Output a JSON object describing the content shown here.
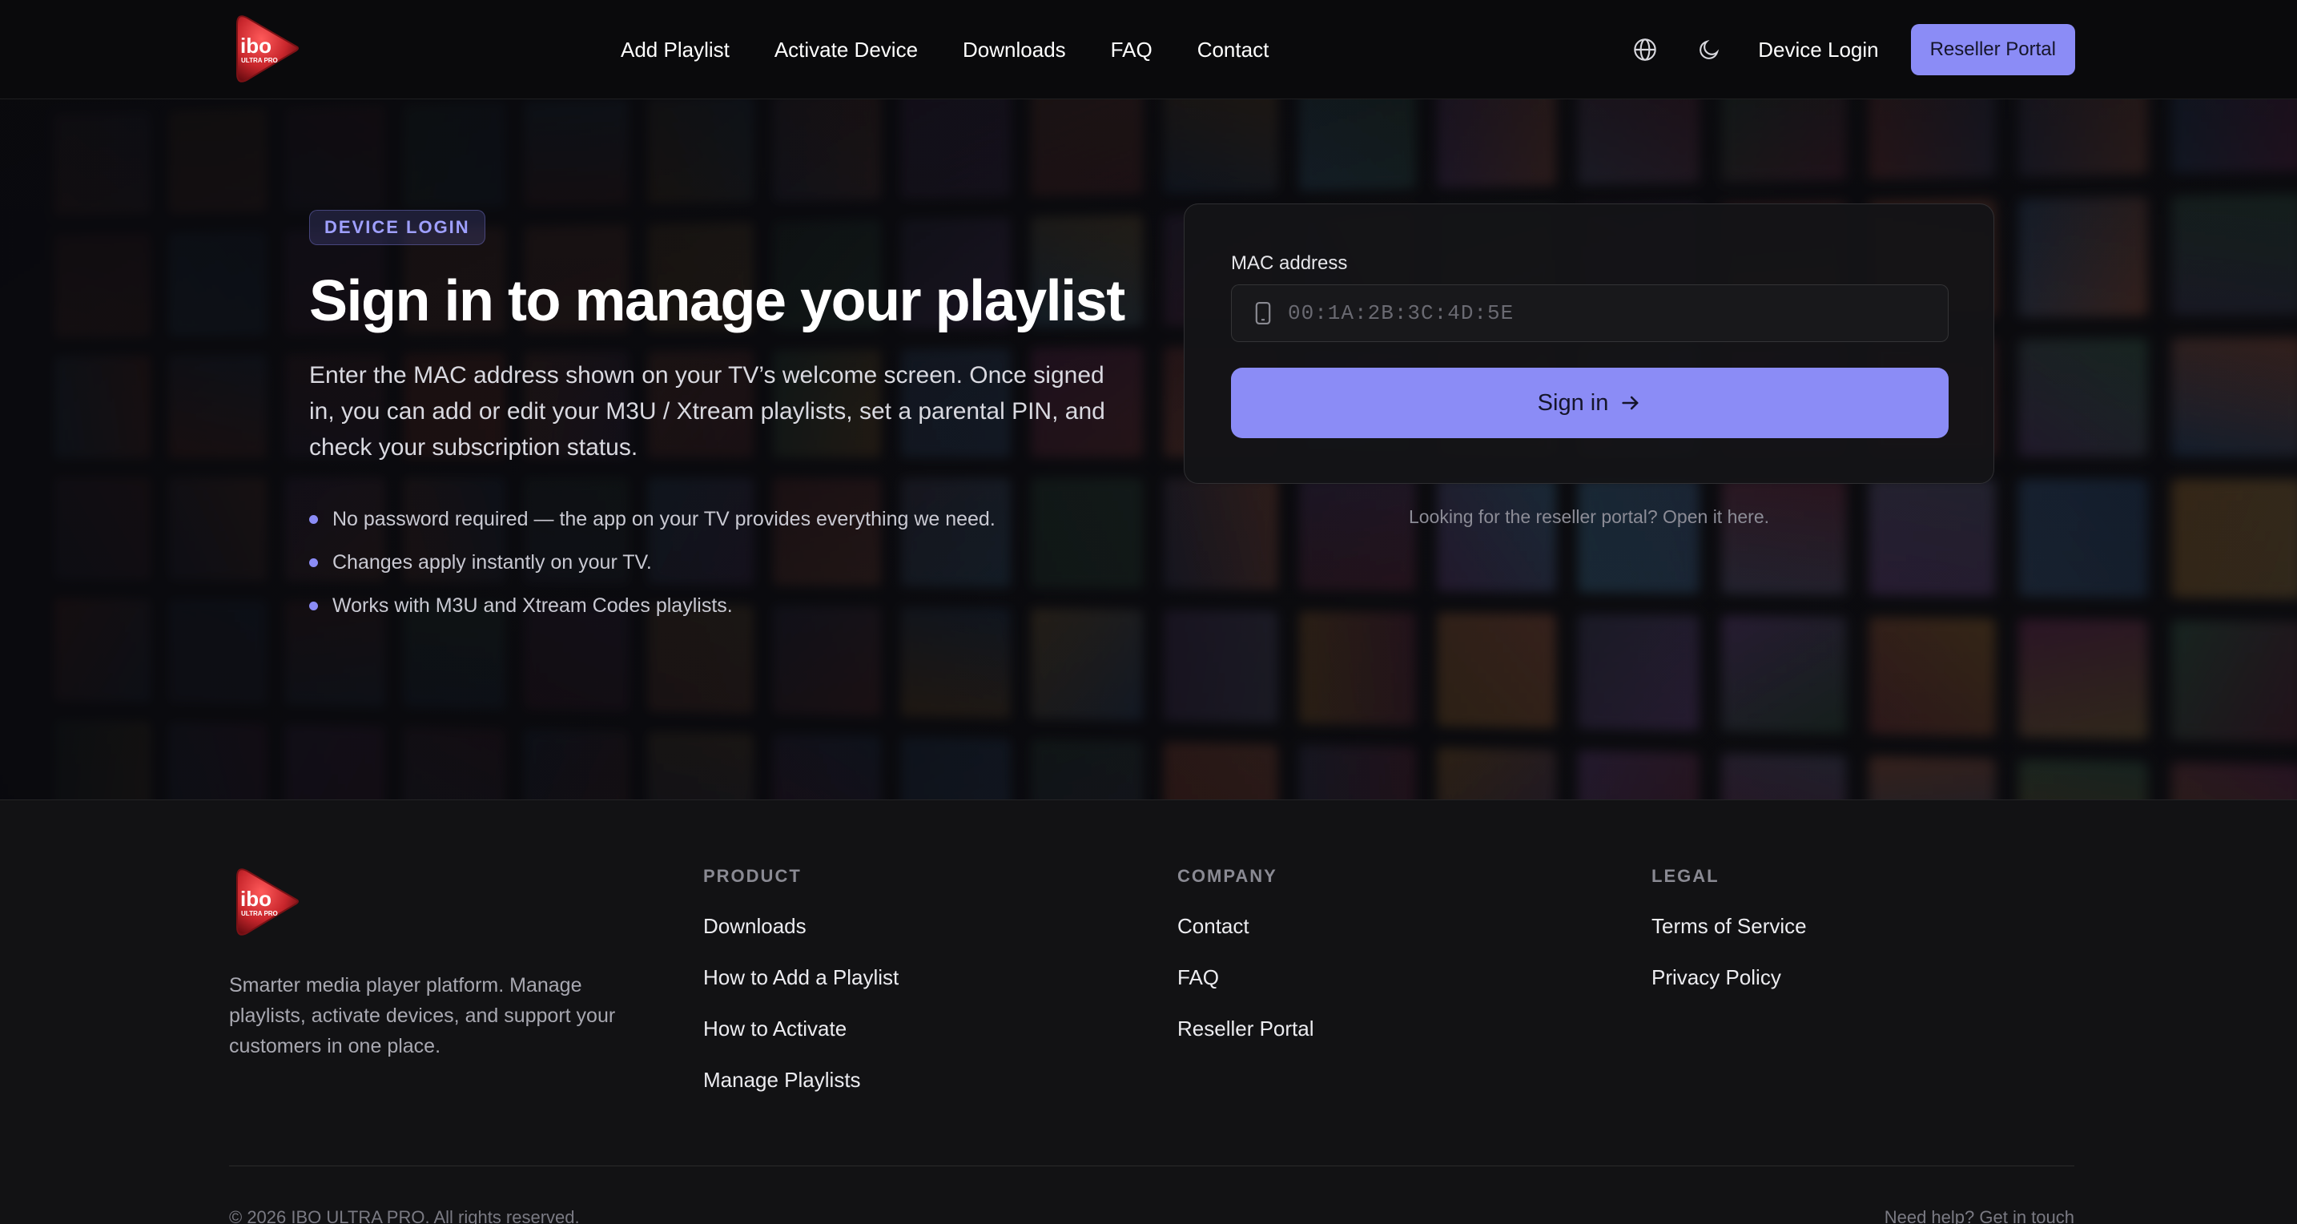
{
  "header": {
    "nav": [
      "Add Playlist",
      "Activate Device",
      "Downloads",
      "FAQ",
      "Contact"
    ],
    "icons": [
      "globe-icon",
      "moon-icon"
    ],
    "device_login": "Device Login",
    "reseller_portal": "Reseller Portal"
  },
  "hero": {
    "badge": "DEVICE LOGIN",
    "title": "Sign in to manage your playlist",
    "lead": "Enter the MAC address shown on your TV’s welcome screen. Once signed in, you can add or edit your M3U / Xtream playlists, set a parental PIN, and check your subscription status.",
    "bullets": [
      "No password required — the app on your TV provides everything we need.",
      "Changes apply instantly on your TV.",
      "Works with M3U and Xtream Codes playlists."
    ]
  },
  "form": {
    "mac_label": "MAC address",
    "mac_placeholder": "00:1A:2B:3C:4D:5E",
    "signin_label": "Sign in",
    "reseller_hint": "Looking for the reseller portal? Open it here."
  },
  "footer": {
    "description": "Smarter media player platform. Manage playlists, activate devices, and support your customers in one place.",
    "columns": [
      {
        "title": "PRODUCT",
        "links": [
          "Downloads",
          "How to Add a Playlist",
          "How to Activate",
          "Manage Playlists"
        ]
      },
      {
        "title": "COMPANY",
        "links": [
          "Contact",
          "FAQ",
          "Reseller Portal"
        ]
      },
      {
        "title": "LEGAL",
        "links": [
          "Terms of Service",
          "Privacy Policy"
        ]
      }
    ],
    "copyright": "© 2026 IBO ULTRA PRO. All rights reserved.",
    "help": "Need help? Get in touch"
  },
  "colors": {
    "accent": "#8b8cf6",
    "background": "#0c0c0f",
    "logo_red": "#c8262c"
  }
}
